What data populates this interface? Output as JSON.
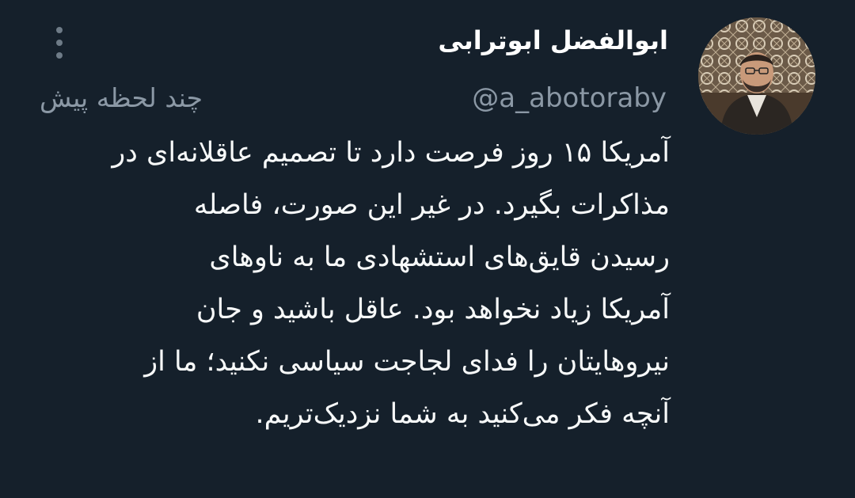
{
  "author": {
    "display_name": "ابوالفضل ابوترابی",
    "handle": "@a_abotoraby"
  },
  "timestamp": "چند لحظه پیش",
  "tweet": {
    "lines": [
      "آمریکا ۱۵ روز فرصت دارد تا تصمیم عاقلانه‌ای در",
      "مذاکرات بگیرد. در غیر این صورت، فاصله",
      "رسیدن قایق‌های استشهادی ما به ناوهای",
      "آمریکا زیاد نخواهد بود. عاقل باشید و جان",
      "نیروهایتان را فدای لجاجت سیاسی نکنید؛ ما از",
      "آنچه فکر می‌کنید به شما نزدیک‌تریم."
    ]
  },
  "icons": {
    "more": "more-vertical-icon",
    "avatar": "profile-photo"
  },
  "colors": {
    "background": "#15202b",
    "text": "#f7f9f9",
    "secondary_text": "#8b98a5"
  }
}
